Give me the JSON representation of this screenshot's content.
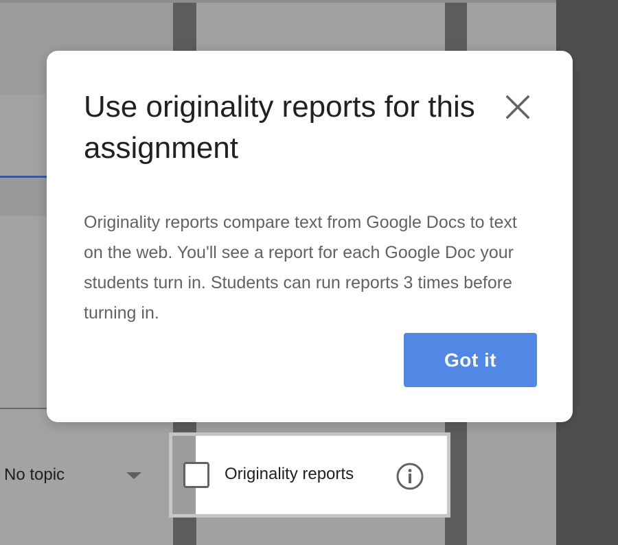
{
  "dialog": {
    "title": "Use originality reports for this assignment",
    "body": "Originality reports compare text from Google Docs to text on the web. You'll see a report for each Google Doc your students turn in. Students can run reports 3 times before turning in.",
    "button_label": "Got it",
    "close_icon": "close-icon",
    "button_color": "#5188e6"
  },
  "topic": {
    "selected": "No topic",
    "caret_icon": "chevron-down-icon"
  },
  "originality": {
    "label": "Originality reports",
    "checked": false,
    "info_icon": "info-icon"
  },
  "colors": {
    "overlay": "#9e9e9e",
    "dialog_bg": "#ffffff",
    "title_text": "#202124",
    "body_text": "#5f6368"
  }
}
